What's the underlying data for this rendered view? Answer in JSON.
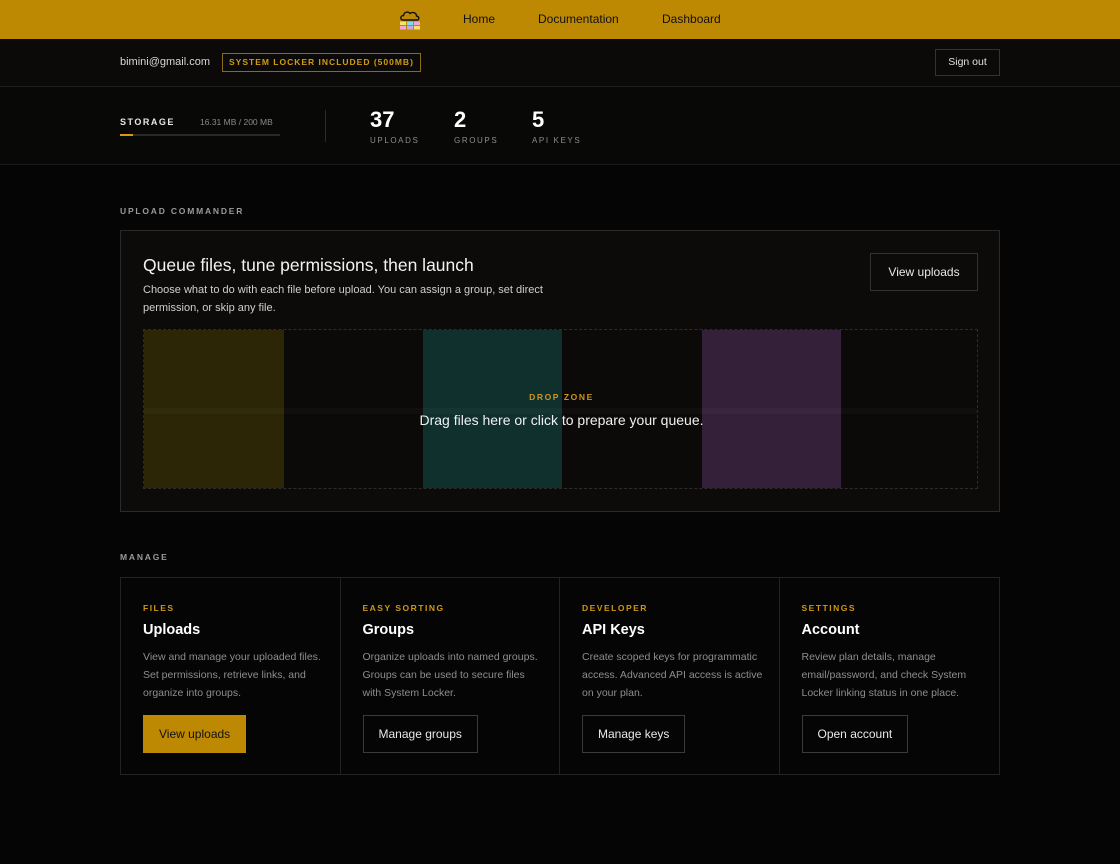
{
  "nav": {
    "links": [
      "Home",
      "Documentation",
      "Dashboard"
    ]
  },
  "account": {
    "email": "bimini@gmail.com",
    "badge": "SYSTEM LOCKER INCLUDED (500MB)",
    "sign_out": "Sign out"
  },
  "stats": {
    "storage_label": "STORAGE",
    "storage_value": "16.31 MB / 200 MB",
    "storage_used_fraction": 0.0816,
    "items": [
      {
        "value": "37",
        "label": "UPLOADS"
      },
      {
        "value": "2",
        "label": "GROUPS"
      },
      {
        "value": "5",
        "label": "API KEYS"
      }
    ]
  },
  "commander": {
    "section_label": "UPLOAD COMMANDER",
    "title": "Queue files, tune permissions, then launch",
    "description": "Choose what to do with each file before upload. You can assign a group, set direct permission, or skip any file.",
    "view_uploads": "View uploads",
    "drop_label": "DROP ZONE",
    "drop_text": "Drag files here or click to prepare your queue.",
    "stripe_colors": [
      "#2c2606",
      "#0b0a08",
      "#10302e",
      "#0b0a08",
      "#35203a",
      "#0b0a08"
    ]
  },
  "manage": {
    "section_label": "MANAGE",
    "cards": [
      {
        "eyebrow": "FILES",
        "title": "Uploads",
        "description": "View and manage your uploaded files. Set permissions, retrieve links, and organize into groups.",
        "button": "View uploads"
      },
      {
        "eyebrow": "EASY SORTING",
        "title": "Groups",
        "description": "Organize uploads into named groups. Groups can be used to secure files with System Locker.",
        "button": "Manage groups"
      },
      {
        "eyebrow": "DEVELOPER",
        "title": "API Keys",
        "description": "Create scoped keys for programmatic access. Advanced API access is active on your plan.",
        "button": "Manage keys"
      },
      {
        "eyebrow": "SETTINGS",
        "title": "Account",
        "description": "Review plan details, manage email/password, and check System Locker linking status in one place.",
        "button": "Open account"
      }
    ]
  },
  "colors": {
    "accent": "#bd8802",
    "background": "#050505"
  },
  "icons": {
    "logo": "cloud-logo-icon"
  }
}
